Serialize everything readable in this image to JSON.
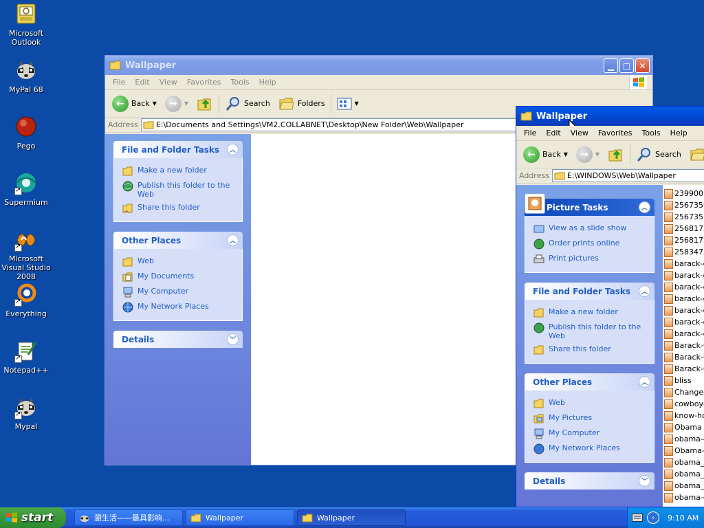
{
  "desktop": {
    "icons": [
      {
        "label": "Microsoft Outlook",
        "icon": "outlook-icon"
      },
      {
        "label": "MyPal 68",
        "icon": "raccoon-icon"
      },
      {
        "label": "Pego",
        "icon": "pego-icon"
      },
      {
        "label": "Supermium",
        "icon": "supermium-icon"
      },
      {
        "label": "Microsoft Visual Studio 2008",
        "icon": "visual-studio-icon"
      },
      {
        "label": "Everything",
        "icon": "everything-icon"
      },
      {
        "label": "Notepad++",
        "icon": "notepadpp-icon"
      },
      {
        "label": "Mypal",
        "icon": "raccoon-icon"
      }
    ]
  },
  "window_back": {
    "title": "Wallpaper",
    "menu": [
      "File",
      "Edit",
      "View",
      "Favorites",
      "Tools",
      "Help"
    ],
    "toolbar": {
      "back": "Back",
      "search": "Search",
      "folders": "Folders"
    },
    "address": {
      "label": "Address",
      "path": "E:\\Documents and Settings\\VM2.COLLABNET\\Desktop\\New Folder\\Web\\Wallpaper"
    },
    "panels": {
      "file_tasks": {
        "title": "File and Folder Tasks",
        "links": [
          "Make a new folder",
          "Publish this folder to the Web",
          "Share this folder"
        ]
      },
      "other_places": {
        "title": "Other Places",
        "links": [
          "Web",
          "My Documents",
          "My Computer",
          "My Network Places"
        ]
      },
      "details": {
        "title": "Details"
      }
    }
  },
  "window_front": {
    "title": "Wallpaper",
    "menu": [
      "File",
      "Edit",
      "View",
      "Favorites",
      "Tools",
      "Help"
    ],
    "toolbar": {
      "back": "Back",
      "search": "Search"
    },
    "address": {
      "label": "Address",
      "path": "E:\\WINDOWS\\Web\\Wallpaper"
    },
    "panels": {
      "picture_tasks": {
        "title": "Picture Tasks",
        "links": [
          "View as a slide show",
          "Order prints online",
          "Print pictures"
        ]
      },
      "file_tasks": {
        "title": "File and Folder Tasks",
        "links": [
          "Make a new folder",
          "Publish this folder to the Web",
          "Share this folder"
        ]
      },
      "other_places": {
        "title": "Other Places",
        "links": [
          "Web",
          "My Pictures",
          "My Computer",
          "My Network Places"
        ]
      },
      "details": {
        "title": "Details"
      }
    },
    "files": [
      "2399007",
      "2567350",
      "2567351",
      "2568172",
      "2568172",
      "2583473",
      "barack-o",
      "barack-o",
      "barack-o",
      "barack-o",
      "barack-o",
      "barack-o",
      "barack-o",
      "Barack-C",
      "Barack-C",
      "Barack-C",
      "bliss",
      "Change-",
      "cowboy-",
      "know-hop",
      "Obama",
      "obama-4",
      "Obama-2",
      "obama_f",
      "obama_f",
      "obama_f",
      "obama-c"
    ]
  },
  "taskbar": {
    "start": "start",
    "buttons": [
      "瀏生活——最具影响...",
      "Wallpaper",
      "Wallpaper"
    ],
    "clock": "9:10 AM"
  },
  "colors": {
    "desktop": "#0b4aa6",
    "titlebar_active": "#0054e3",
    "titlebar_inactive": "#7b98e3",
    "taskpane_link": "#215dc6",
    "start_green": "#3c9a3c"
  }
}
